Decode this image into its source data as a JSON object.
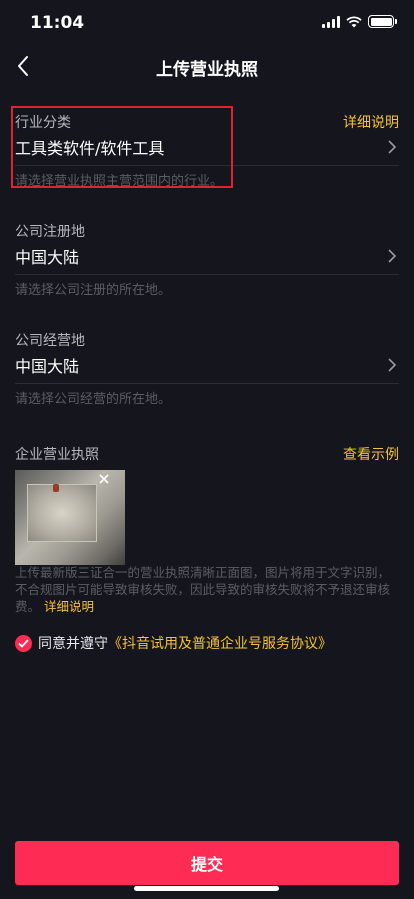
{
  "status_bar": {
    "time": "11:04"
  },
  "nav": {
    "title": "上传营业执照"
  },
  "industry": {
    "label": "行业分类",
    "detail_link": "详细说明",
    "value": "工具类软件/软件工具",
    "hint": "请选择营业执照主营范围内的行业。"
  },
  "registered_location": {
    "label": "公司注册地",
    "value": "中国大陆",
    "hint": "请选择公司注册的所在地。"
  },
  "operating_location": {
    "label": "公司经营地",
    "value": "中国大陆",
    "hint": "请选择公司经营的所在地。"
  },
  "license": {
    "label": "企业营业执照",
    "example_link": "查看示例",
    "description": "上传最新版三证合一的营业执照清晰正面图，图片将用于文字识别，不合规图片可能导致审核失败，因此导致的审核失败将不予退还审核费。",
    "detail_link": "详细说明"
  },
  "agreement": {
    "checked": true,
    "text": "同意并遵守",
    "link": "《抖音试用及普通企业号服务协议》"
  },
  "submit": {
    "label": "提交"
  },
  "colors": {
    "background": "#15161d",
    "accent_red": "#fe2c55",
    "link_yellow": "#f5c232",
    "highlight_border": "#e0242f"
  },
  "icons": [
    "back-icon",
    "chevron-right-icon",
    "close-icon",
    "check-icon",
    "signal-icon",
    "wifi-icon",
    "battery-icon"
  ]
}
